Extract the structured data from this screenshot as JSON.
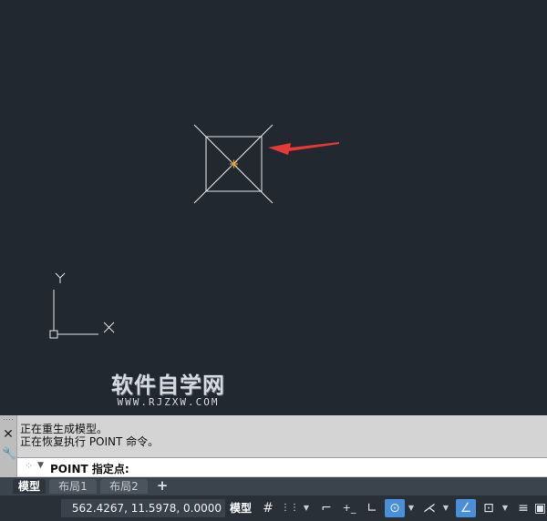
{
  "viewport": {
    "axes": {
      "x_label": "X",
      "y_label": "Y"
    },
    "watermark": {
      "title": "软件自学网",
      "subtitle": "WWW.RJZXW.COM"
    },
    "colors": {
      "background": "#212830",
      "geometry": "#e8e8e8",
      "point_marker": "#e0a64a",
      "arrow": "#e53935"
    }
  },
  "command_window": {
    "history": [
      "正在重生成模型。",
      "正在恢复执行 POINT 命令。"
    ],
    "prompt": "POINT 指定点:"
  },
  "layout_tabs": [
    {
      "label": "模型",
      "active": true
    },
    {
      "label": "布局1",
      "active": false
    },
    {
      "label": "布局2",
      "active": false
    }
  ],
  "add_tab": "+",
  "status_bar": {
    "coordinates": "562.4267, 11.5978, 0.0000",
    "model_label": "模型",
    "icons": [
      {
        "name": "grid-icon",
        "glyph": "#",
        "on": false
      },
      {
        "name": "snap-icon",
        "glyph": "⋮⋮",
        "on": false
      },
      {
        "name": "infer-constraints-icon",
        "glyph": "⌐",
        "on": false
      },
      {
        "name": "dynamic-input-icon",
        "glyph": "+_",
        "on": false
      },
      {
        "name": "ortho-icon",
        "glyph": "∟",
        "on": false
      },
      {
        "name": "polar-tracking-icon",
        "glyph": "⊙",
        "on": true
      },
      {
        "name": "object-snap-tracking-icon",
        "glyph": "⋌",
        "on": false
      },
      {
        "name": "isodraft-icon",
        "glyph": "∠",
        "on": true
      },
      {
        "name": "object-snap-icon",
        "glyph": "⊡",
        "on": false
      },
      {
        "name": "lineweight-icon",
        "glyph": "≡",
        "on": false
      },
      {
        "name": "transparency-icon",
        "glyph": "▣",
        "on": false
      }
    ]
  }
}
